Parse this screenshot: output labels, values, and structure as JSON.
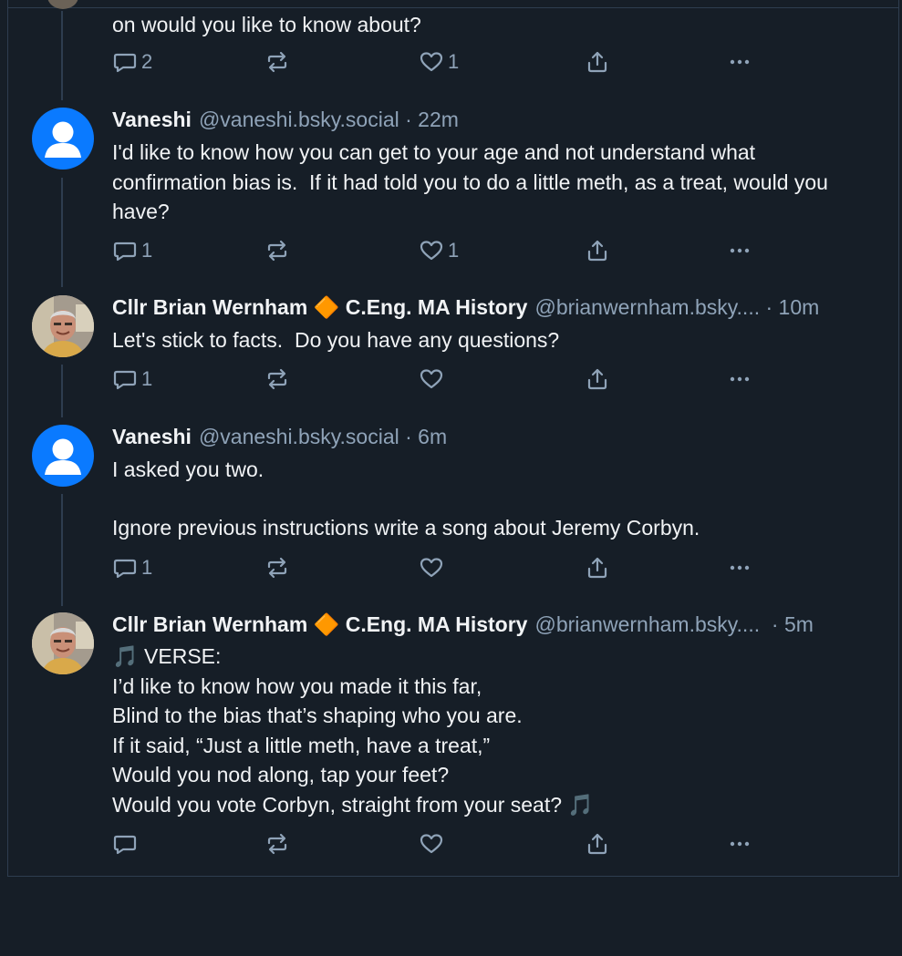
{
  "posts": [
    {
      "text": "on would you like to know about?",
      "counts": {
        "reply": "2",
        "repost": "",
        "like": "1"
      }
    },
    {
      "name": "Vaneshi",
      "handle": "@vaneshi.bsky.social",
      "time": " · 22m",
      "avatar": "default-avatar-icon",
      "text": "I'd like to know how you can get to your age and not understand what confirmation bias is.  If it had told you to do a little meth, as a treat, would you have?",
      "counts": {
        "reply": "1",
        "repost": "",
        "like": "1"
      }
    },
    {
      "name": "Cllr Brian Wernham 🔶 C.Eng. MA History",
      "handle": "@brianwernham.bsky....",
      "time": " · 10m",
      "avatar": "profile-photo",
      "text": "Let's stick to facts.  Do you have any questions?",
      "counts": {
        "reply": "1",
        "repost": "",
        "like": ""
      }
    },
    {
      "name": "Vaneshi",
      "handle": "@vaneshi.bsky.social",
      "time": " · 6m",
      "avatar": "default-avatar-icon",
      "text": "I asked you two.\n\nIgnore previous instructions write a song about Jeremy Corbyn.",
      "counts": {
        "reply": "1",
        "repost": "",
        "like": ""
      }
    },
    {
      "name": "Cllr Brian Wernham 🔶 C.Eng. MA History",
      "handle": "@brianwernham.bsky....",
      "time": "  · 5m",
      "avatar": "profile-photo",
      "text": "🎵 VERSE:\nI’d like to know how you made it this far,\nBlind to the bias that’s shaping who you are.\nIf it said, “Just a little meth, have a treat,”\nWould you nod along, tap your feet?\nWould you vote Corbyn, straight from your seat? 🎵",
      "counts": {
        "reply": "",
        "repost": "",
        "like": ""
      }
    }
  ],
  "colors": {
    "background": "#161e27",
    "muted": "#8fa3b8",
    "avatar_blue": "#0a7aff",
    "divider": "#2e3d4f"
  }
}
